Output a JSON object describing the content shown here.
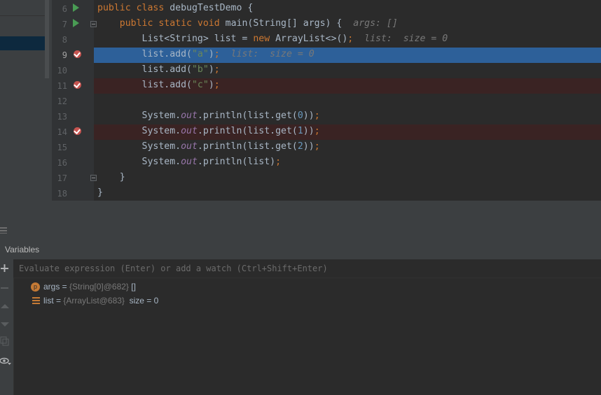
{
  "editor": {
    "lines": [
      {
        "num": "6",
        "parts": [
          {
            "t": "public class ",
            "c": "kw"
          },
          {
            "t": "debugTestDemo {",
            "c": ""
          }
        ]
      },
      {
        "num": "7",
        "parts": [
          {
            "t": "    public static void ",
            "c": "kw"
          },
          {
            "t": "main(String[] args) {  ",
            "c": ""
          },
          {
            "t": "args: []",
            "c": "hint"
          }
        ]
      },
      {
        "num": "8",
        "parts": [
          {
            "t": "        List<String> list = ",
            "c": ""
          },
          {
            "t": "new ",
            "c": "kw"
          },
          {
            "t": "ArrayList<>()",
            "c": ""
          },
          {
            "t": ";",
            "c": "kw"
          },
          {
            "t": "  list:  size = 0",
            "c": "hint"
          }
        ]
      },
      {
        "num": "9",
        "parts": [
          {
            "t": "        list.add(",
            "c": ""
          },
          {
            "t": "\"a\"",
            "c": "str"
          },
          {
            "t": ")",
            "c": ""
          },
          {
            "t": ";",
            "c": "kw"
          },
          {
            "t": "  list:  size = 0",
            "c": "hint"
          }
        ]
      },
      {
        "num": "10",
        "parts": [
          {
            "t": "        list.add(",
            "c": ""
          },
          {
            "t": "\"b\"",
            "c": "str"
          },
          {
            "t": ")",
            "c": ""
          },
          {
            "t": ";",
            "c": "kw"
          }
        ]
      },
      {
        "num": "11",
        "parts": [
          {
            "t": "        list.add(",
            "c": ""
          },
          {
            "t": "\"c\"",
            "c": "str"
          },
          {
            "t": ")",
            "c": ""
          },
          {
            "t": ";",
            "c": "kw"
          }
        ]
      },
      {
        "num": "12",
        "parts": []
      },
      {
        "num": "13",
        "parts": [
          {
            "t": "        System.",
            "c": ""
          },
          {
            "t": "out",
            "c": "fld"
          },
          {
            "t": ".println(list.get(",
            "c": ""
          },
          {
            "t": "0",
            "c": "num"
          },
          {
            "t": "))",
            "c": ""
          },
          {
            "t": ";",
            "c": "kw"
          }
        ]
      },
      {
        "num": "14",
        "parts": [
          {
            "t": "        System.",
            "c": ""
          },
          {
            "t": "out",
            "c": "fld"
          },
          {
            "t": ".println(list.get(",
            "c": ""
          },
          {
            "t": "1",
            "c": "num"
          },
          {
            "t": "))",
            "c": ""
          },
          {
            "t": ";",
            "c": "kw"
          }
        ]
      },
      {
        "num": "15",
        "parts": [
          {
            "t": "        System.",
            "c": ""
          },
          {
            "t": "out",
            "c": "fld"
          },
          {
            "t": ".println(list.get(",
            "c": ""
          },
          {
            "t": "2",
            "c": "num"
          },
          {
            "t": "))",
            "c": ""
          },
          {
            "t": ";",
            "c": "kw"
          }
        ]
      },
      {
        "num": "16",
        "parts": [
          {
            "t": "        System.",
            "c": ""
          },
          {
            "t": "out",
            "c": "fld"
          },
          {
            "t": ".println(list)",
            "c": ""
          },
          {
            "t": ";",
            "c": "kw"
          }
        ]
      },
      {
        "num": "17",
        "parts": [
          {
            "t": "    }",
            "c": ""
          }
        ]
      },
      {
        "num": "18",
        "parts": [
          {
            "t": "}",
            "c": ""
          }
        ]
      }
    ],
    "current_line": "9",
    "breakpoint_lines": [
      "9",
      "11",
      "14"
    ],
    "run_lines": [
      "6",
      "7"
    ]
  },
  "debug": {
    "panel_title": "Variables",
    "eval_placeholder": "Evaluate expression (Enter) or add a watch (Ctrl+Shift+Enter)",
    "variables": [
      {
        "icon": "p",
        "name": "args",
        "eq": " = ",
        "ref": "{String[0]@682}",
        "value": " []"
      },
      {
        "icon": "list",
        "name": "list",
        "eq": " = ",
        "ref": "{ArrayList@683}",
        "value": "  size = 0"
      }
    ]
  },
  "colors": {
    "current_line_bg": "#2d6099",
    "breakpoint_bg": "#3a2323",
    "breakpoint": "#c75450",
    "run_icon": "#499c54"
  }
}
